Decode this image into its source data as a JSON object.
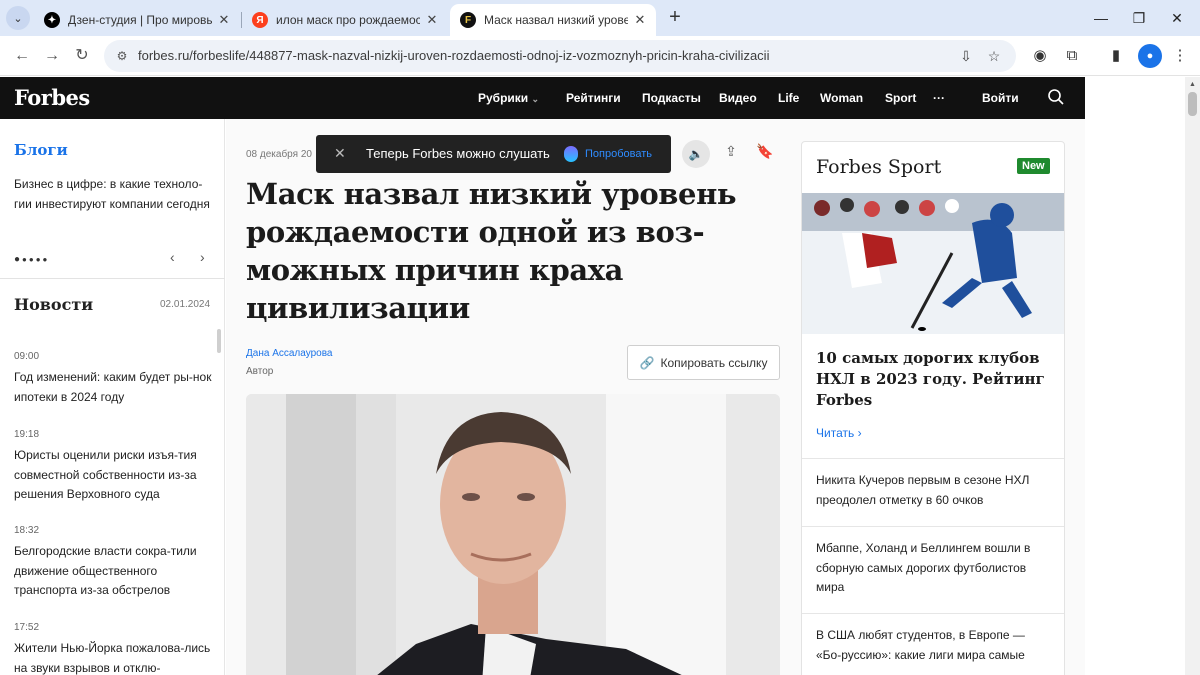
{
  "browser": {
    "tabs": [
      {
        "title": "Дзен-студия | Про мировые те",
        "favicon": "zen-icon",
        "active": false
      },
      {
        "title": "илон маск про рождаемость –",
        "favicon": "yandex-icon",
        "active": false
      },
      {
        "title": "Маск назвал низкий уровень р",
        "favicon": "forbes-icon",
        "active": true
      }
    ],
    "favicon_letters": {
      "yandex": "Я",
      "forbes": "F"
    },
    "url": "forbes.ru/forbeslife/448877-mask-nazval-nizkij-uroven-rozdaemosti-odnoj-iz-vozmoznyh-pricin-kraha-civilizacii"
  },
  "site": {
    "logo": "Forbes",
    "nav": [
      "Рубрики",
      "Рейтинги",
      "Подкасты",
      "Видео",
      "Life",
      "Woman",
      "Sport",
      "···"
    ],
    "login": "Войти"
  },
  "left": {
    "blogs_title": "Блоги",
    "blogs_text": "Бизнес в цифре: в какие техноло-гии инвестируют компании сегодня",
    "news_title": "Новости",
    "news_date": "02.01.2024",
    "news": [
      {
        "time": "09:00",
        "headline": "Год изменений: каким будет ры-нок ипотеки в 2024 году"
      },
      {
        "time": "19:18",
        "headline": "Юристы оценили риски изъя-тия совместной собственности из-за решения Верховного суда"
      },
      {
        "time": "18:32",
        "headline": "Белгородские власти сокра-тили движение общественного транспорта из-за обстрелов"
      },
      {
        "time": "17:52",
        "headline": "Жители Нью-Йорка пожалова-лись на звуки взрывов и отклю-"
      }
    ]
  },
  "article": {
    "date": "08 декабря 20",
    "toast_text": "Теперь Forbes можно слушать",
    "toast_action": "Попробовать",
    "headline": "Маск назвал низкий уровень рождаемости одной из воз-можных причин краха цивилизации",
    "author": "Дана Ассалаурова",
    "author_role": "Автор",
    "copy_link": "Копировать ссылку"
  },
  "sport": {
    "title": "Forbes Sport",
    "badge": "New",
    "headline": "10 самых дорогих клубов НХЛ в 2023 году. Рейтинг Forbes",
    "read": "Читать",
    "items": [
      "Никита Кучеров первым в сезоне НХЛ преодолел отметку в 60 очков",
      "Мбаппе, Холанд и Беллингем вошли в сборную самых дорогих футболистов мира",
      "В США любят студентов, в Европе — «Бо-руссию»: какие лиги мира самые"
    ]
  },
  "colors": {
    "accent": "#1a73e8",
    "header": "#111111",
    "badge": "#1f8a2e"
  }
}
